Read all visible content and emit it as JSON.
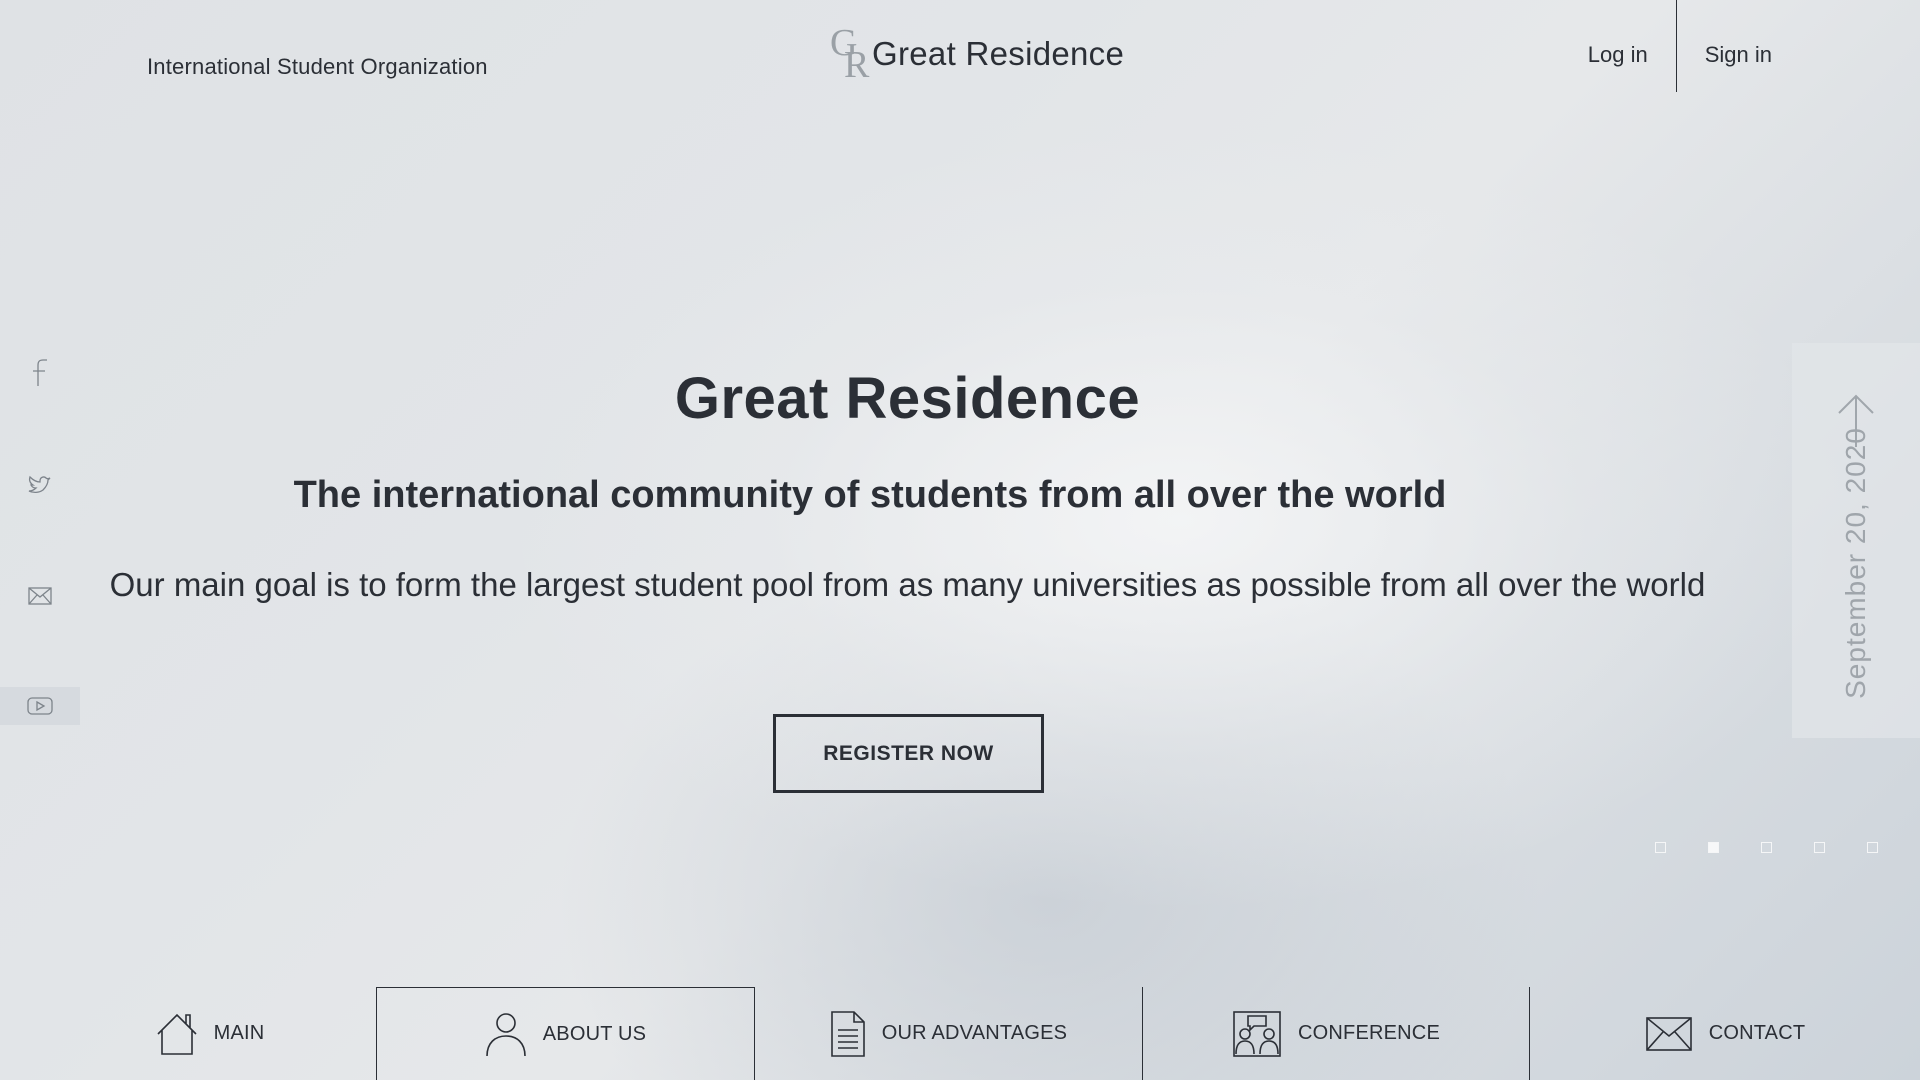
{
  "header": {
    "org_name": "International Student Organization",
    "brand": {
      "mark_g": "G",
      "mark_r": "R",
      "name": "Great Residence"
    },
    "auth": {
      "login": "Log in",
      "signin": "Sign in"
    }
  },
  "social": [
    {
      "icon": "facebook-icon"
    },
    {
      "icon": "twitter-icon"
    },
    {
      "icon": "mail-icon"
    },
    {
      "icon": "youtube-icon",
      "active": true
    }
  ],
  "hero": {
    "title": "Great Residence",
    "subtitle": "The international community of students from all over the world",
    "text": "Our main goal is to form the largest student pool from as many universities as possible from all over the world",
    "cta": "REGISTER NOW"
  },
  "date_panel": {
    "date": "September 20, 2020",
    "icon": "arrow-up-icon"
  },
  "slider": {
    "count": 5,
    "active_index": 1
  },
  "nav": [
    {
      "label": "MAIN",
      "icon": "home-icon"
    },
    {
      "label": "ABOUT US",
      "icon": "user-icon",
      "active": true
    },
    {
      "label": "OUR ADVANTAGES",
      "icon": "document-icon"
    },
    {
      "label": "CONFERENCE",
      "icon": "conference-icon"
    },
    {
      "label": "CONTACT",
      "icon": "envelope-icon"
    }
  ],
  "colors": {
    "text": "#2b2f36",
    "muted": "#9fa5ab",
    "background": "#e2e5e8"
  }
}
